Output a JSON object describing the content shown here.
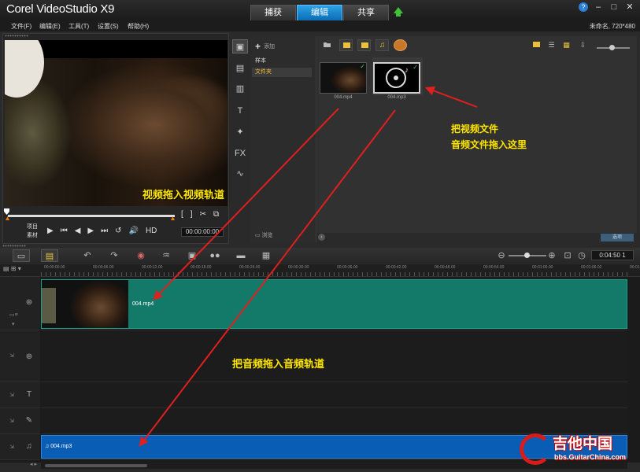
{
  "app": {
    "title": "Corel VideoStudio X9",
    "project_info": "未命名, 720*480"
  },
  "mode_tabs": [
    {
      "label": "捕获",
      "active": false
    },
    {
      "label": "编辑",
      "active": true
    },
    {
      "label": "共享",
      "active": false
    }
  ],
  "window_buttons": {
    "help": "?",
    "minimize": "–",
    "maximize": "□",
    "close": "✕"
  },
  "menu": [
    "文件(F)",
    "编辑(E)",
    "工具(T)",
    "设置(S)",
    "帮助(H)"
  ],
  "preview": {
    "caption": "视频拖入视频轨道",
    "mode_project": "项目",
    "mode_clip": "素材",
    "timecode": "00:00:00:00",
    "play_controls": [
      "▶",
      "⏮",
      "◀",
      "▶",
      "⏭",
      "↺",
      "🔊",
      "HD"
    ],
    "bracket_controls": [
      "[",
      "]",
      "✂",
      "⧉"
    ]
  },
  "library": {
    "add_label": "添加",
    "tree": [
      {
        "label": "样本",
        "selected": false
      },
      {
        "label": "文件夹",
        "selected": true
      }
    ],
    "browse_label": "浏览",
    "options_label": "选项",
    "items": [
      {
        "name": "004.mp4",
        "type": "video"
      },
      {
        "name": "004.mp3",
        "type": "audio"
      }
    ],
    "annotation": [
      "把视频文件",
      "音频文件拖入这里"
    ]
  },
  "timeline": {
    "duration": "0:04:50 1",
    "ruler": [
      "00:00:00.00",
      "00:00:06.00",
      "00:00:12.00",
      "00:00:18.00",
      "00:00:24.00",
      "00:00:30.00",
      "00:00:36.00",
      "00:00:42.00",
      "00:00:48.00",
      "00:00:54.00",
      "00:01:00.00",
      "00:01:06.02",
      "00:01:12.00"
    ],
    "video_clip": "004.mp4",
    "audio_clip": "004.mp3",
    "annotation": "把音频拖入音频轨道"
  },
  "watermark": {
    "name": "吉他中国",
    "url": "bbs.GuitarChina.com"
  },
  "colors": {
    "accent": "#1a8fd9",
    "video_track": "#137a69",
    "audio_track": "#0a5db5",
    "annotation": "#ffe600",
    "arrow": "#e01f1f"
  }
}
